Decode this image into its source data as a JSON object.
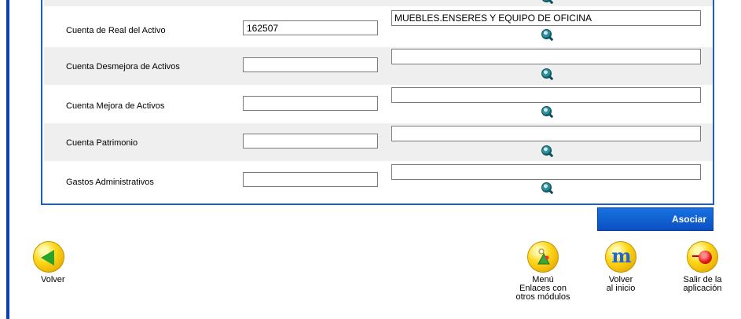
{
  "form": {
    "rows": [
      {
        "label": "Cuenta de Real del Activo",
        "code": "162507",
        "description": "MUEBLES.ENSERES Y EQUIPO DE OFICINA"
      },
      {
        "label": "Cuenta Desmejora de Activos",
        "code": "",
        "description": ""
      },
      {
        "label": "Cuenta Mejora de Activos",
        "code": "",
        "description": ""
      },
      {
        "label": "Cuenta Patrimonio",
        "code": "",
        "description": ""
      },
      {
        "label": "Gastos Administrativos",
        "code": "",
        "description": ""
      }
    ],
    "search_icon": "search-icon"
  },
  "actions": {
    "asociar_label": "Asociar"
  },
  "nav": {
    "volver_label": "Volver",
    "menu_label_line1": "Menú",
    "menu_label_line2": "Enlaces con",
    "menu_label_line3": "otros módulos",
    "inicio_label_line1": "Volver",
    "inicio_label_line2": "al inicio",
    "salir_label_line1": "Salir de la",
    "salir_label_line2": "aplicación"
  },
  "colors": {
    "panel_border": "#1b5fc9",
    "button_blue": "#0a4fc2",
    "icon_yellow": "#ffd81a",
    "row_alt": "#efefef"
  }
}
